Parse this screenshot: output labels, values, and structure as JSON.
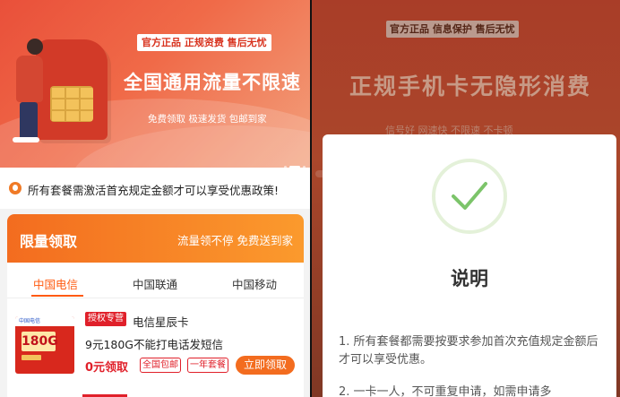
{
  "left": {
    "banner": {
      "tags": "官方正品 正规资费 售后无忧",
      "title": "全国通用流量不限速",
      "subtitle": "免费领取 极速发货 包邮到家"
    },
    "notice": "所有套餐需激活首充规定金额才可以享受优惠政策!",
    "card": {
      "header_title": "限量领取",
      "header_slogan": "流量领不停 免费送到家",
      "tabs": [
        "中国电信",
        "中国联通",
        "中国移动"
      ],
      "active_tab": "中国电信"
    },
    "product": {
      "thumb_text": "180G",
      "thumb_header": "中国电信",
      "badge": "授权专营",
      "name": "电信星辰卡",
      "desc": "9元180G不能打电话发短信",
      "price": "0元领取",
      "chips": [
        "全国包邮",
        "一年套餐"
      ],
      "button": "立即领取"
    }
  },
  "right": {
    "tags": "官方正品 信息保护 售后无忧",
    "title": "正规手机卡无隐形消费",
    "subtitle": "信号好 网速快 不限速 不卡顿",
    "modal": {
      "title": "说明",
      "items": [
        "1. 所有套餐都需要按要求参加首次充值规定金额后才可以享受优惠。",
        "2. 一卡一人，不可重复申请，如需申请多"
      ]
    }
  },
  "colors": {
    "accent_red": "#e0202a",
    "accent_orange": "#f36c1f",
    "check_green": "#7cc46a"
  }
}
